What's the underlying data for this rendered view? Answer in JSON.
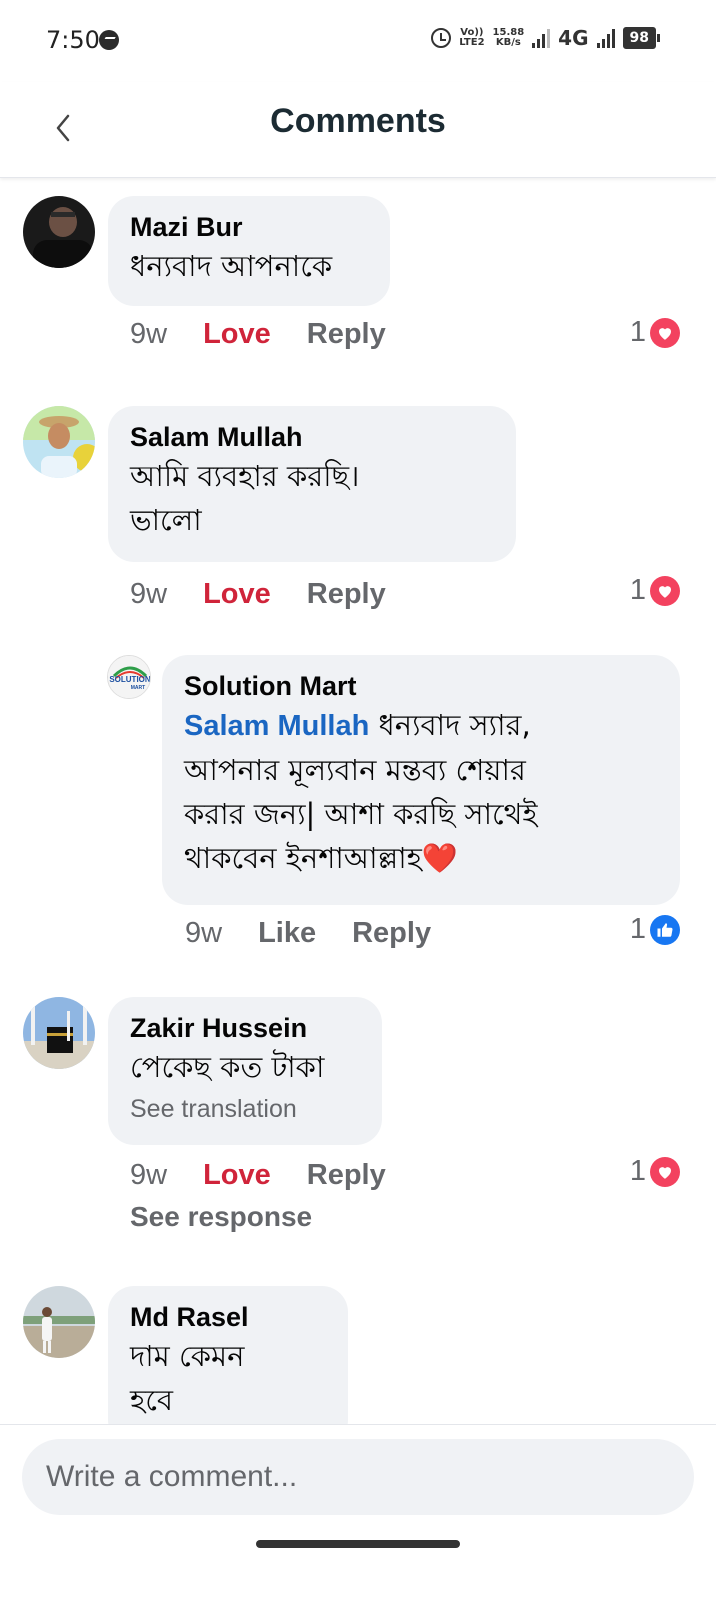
{
  "status_bar": {
    "time": "7:50",
    "volte": "Vo))",
    "lte": "LTE2",
    "speed": "15.88",
    "speed_unit": "KB/s",
    "network": "4G",
    "battery": "98"
  },
  "header": {
    "title": "Comments"
  },
  "comments": [
    {
      "name": "Mazi Bur",
      "text": "ধন্যবাদ আপনাকে",
      "time": "9w",
      "reaction_action": "Love",
      "reply_label": "Reply",
      "reaction_count": "1",
      "reaction_type": "heart"
    },
    {
      "name": "Salam Mullah",
      "text_line1": "আমি ব্যবহার করছি।",
      "text_line2": "ভালো",
      "time": "9w",
      "reaction_action": "Love",
      "reply_label": "Reply",
      "reaction_count": "1",
      "reaction_type": "heart"
    },
    {
      "name": "Solution Mart",
      "avatar_label": "SOLUTION MART",
      "mention": "Salam Mullah",
      "text_line1": " ধন্যবাদ স্যার,",
      "text_line2": "আপনার মূল্যবান মন্তব্য শেয়ার",
      "text_line3": "করার জন্য| আশা করছি সাথেই",
      "text_line4": "থাকবেন ইনশাআল্লাহ",
      "emoji": "❤️",
      "time": "9w",
      "reaction_action": "Like",
      "reply_label": "Reply",
      "reaction_count": "1",
      "reaction_type": "like",
      "is_reply": true
    },
    {
      "name": "Zakir Hussein",
      "text": "পেকেছ কত টাকা",
      "see_translation": "See translation",
      "time": "9w",
      "reaction_action": "Love",
      "reply_label": "Reply",
      "reaction_count": "1",
      "reaction_type": "heart",
      "see_response": "See response"
    },
    {
      "name": "Md Rasel",
      "text_line1": "দাম কেমন",
      "text_line2": "হবে"
    }
  ],
  "composer": {
    "placeholder": "Write a comment..."
  },
  "colors": {
    "love": "#d0243a",
    "mention": "#1a66c2",
    "bubble": "#f0f2f5",
    "heart_badge": "#f3425f",
    "like_badge": "#1877f2"
  }
}
